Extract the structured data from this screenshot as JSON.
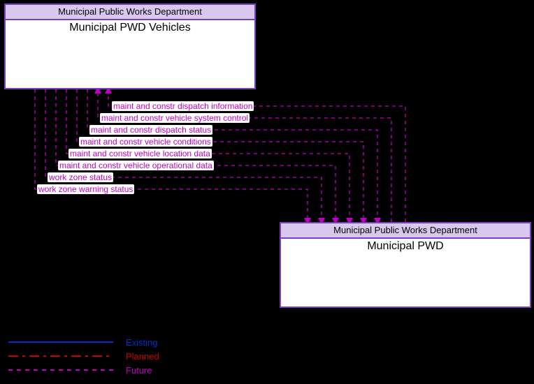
{
  "entities": {
    "top": {
      "org": "Municipal Public Works Department",
      "name": "Municipal PWD Vehicles"
    },
    "bottom": {
      "org": "Municipal Public Works Department",
      "name": "Municipal PWD"
    }
  },
  "flows": [
    {
      "id": "f1",
      "label": "maint and constr dispatch information",
      "dir": "to_top"
    },
    {
      "id": "f2",
      "label": "maint and constr vehicle system control",
      "dir": "to_top"
    },
    {
      "id": "f3",
      "label": "maint and constr dispatch status",
      "dir": "to_bottom"
    },
    {
      "id": "f4",
      "label": "maint and constr vehicle conditions",
      "dir": "to_bottom"
    },
    {
      "id": "f5",
      "label": "maint and constr vehicle location data",
      "dir": "to_bottom"
    },
    {
      "id": "f6",
      "label": "maint and constr vehicle operational data",
      "dir": "to_bottom"
    },
    {
      "id": "f7",
      "label": "work zone status",
      "dir": "to_bottom"
    },
    {
      "id": "f8",
      "label": "work zone warning status",
      "dir": "to_bottom"
    }
  ],
  "legend": {
    "existing": "Existing",
    "planned": "Planned",
    "future": "Future"
  },
  "chart_data": {
    "type": "diagram",
    "nodes": [
      {
        "id": "vehicles",
        "org": "Municipal Public Works Department",
        "name": "Municipal PWD Vehicles"
      },
      {
        "id": "pwd",
        "org": "Municipal Public Works Department",
        "name": "Municipal PWD"
      }
    ],
    "edges": [
      {
        "from": "pwd",
        "to": "vehicles",
        "label": "maint and constr dispatch information",
        "status": "Future"
      },
      {
        "from": "pwd",
        "to": "vehicles",
        "label": "maint and constr vehicle system control",
        "status": "Future"
      },
      {
        "from": "vehicles",
        "to": "pwd",
        "label": "maint and constr dispatch status",
        "status": "Future"
      },
      {
        "from": "vehicles",
        "to": "pwd",
        "label": "maint and constr vehicle conditions",
        "status": "Future"
      },
      {
        "from": "vehicles",
        "to": "pwd",
        "label": "maint and constr vehicle location data",
        "status": "Future"
      },
      {
        "from": "vehicles",
        "to": "pwd",
        "label": "maint and constr vehicle operational data",
        "status": "Future"
      },
      {
        "from": "vehicles",
        "to": "pwd",
        "label": "work zone status",
        "status": "Future"
      },
      {
        "from": "vehicles",
        "to": "pwd",
        "label": "work zone warning status",
        "status": "Future"
      }
    ],
    "legend": [
      "Existing",
      "Planned",
      "Future"
    ]
  }
}
